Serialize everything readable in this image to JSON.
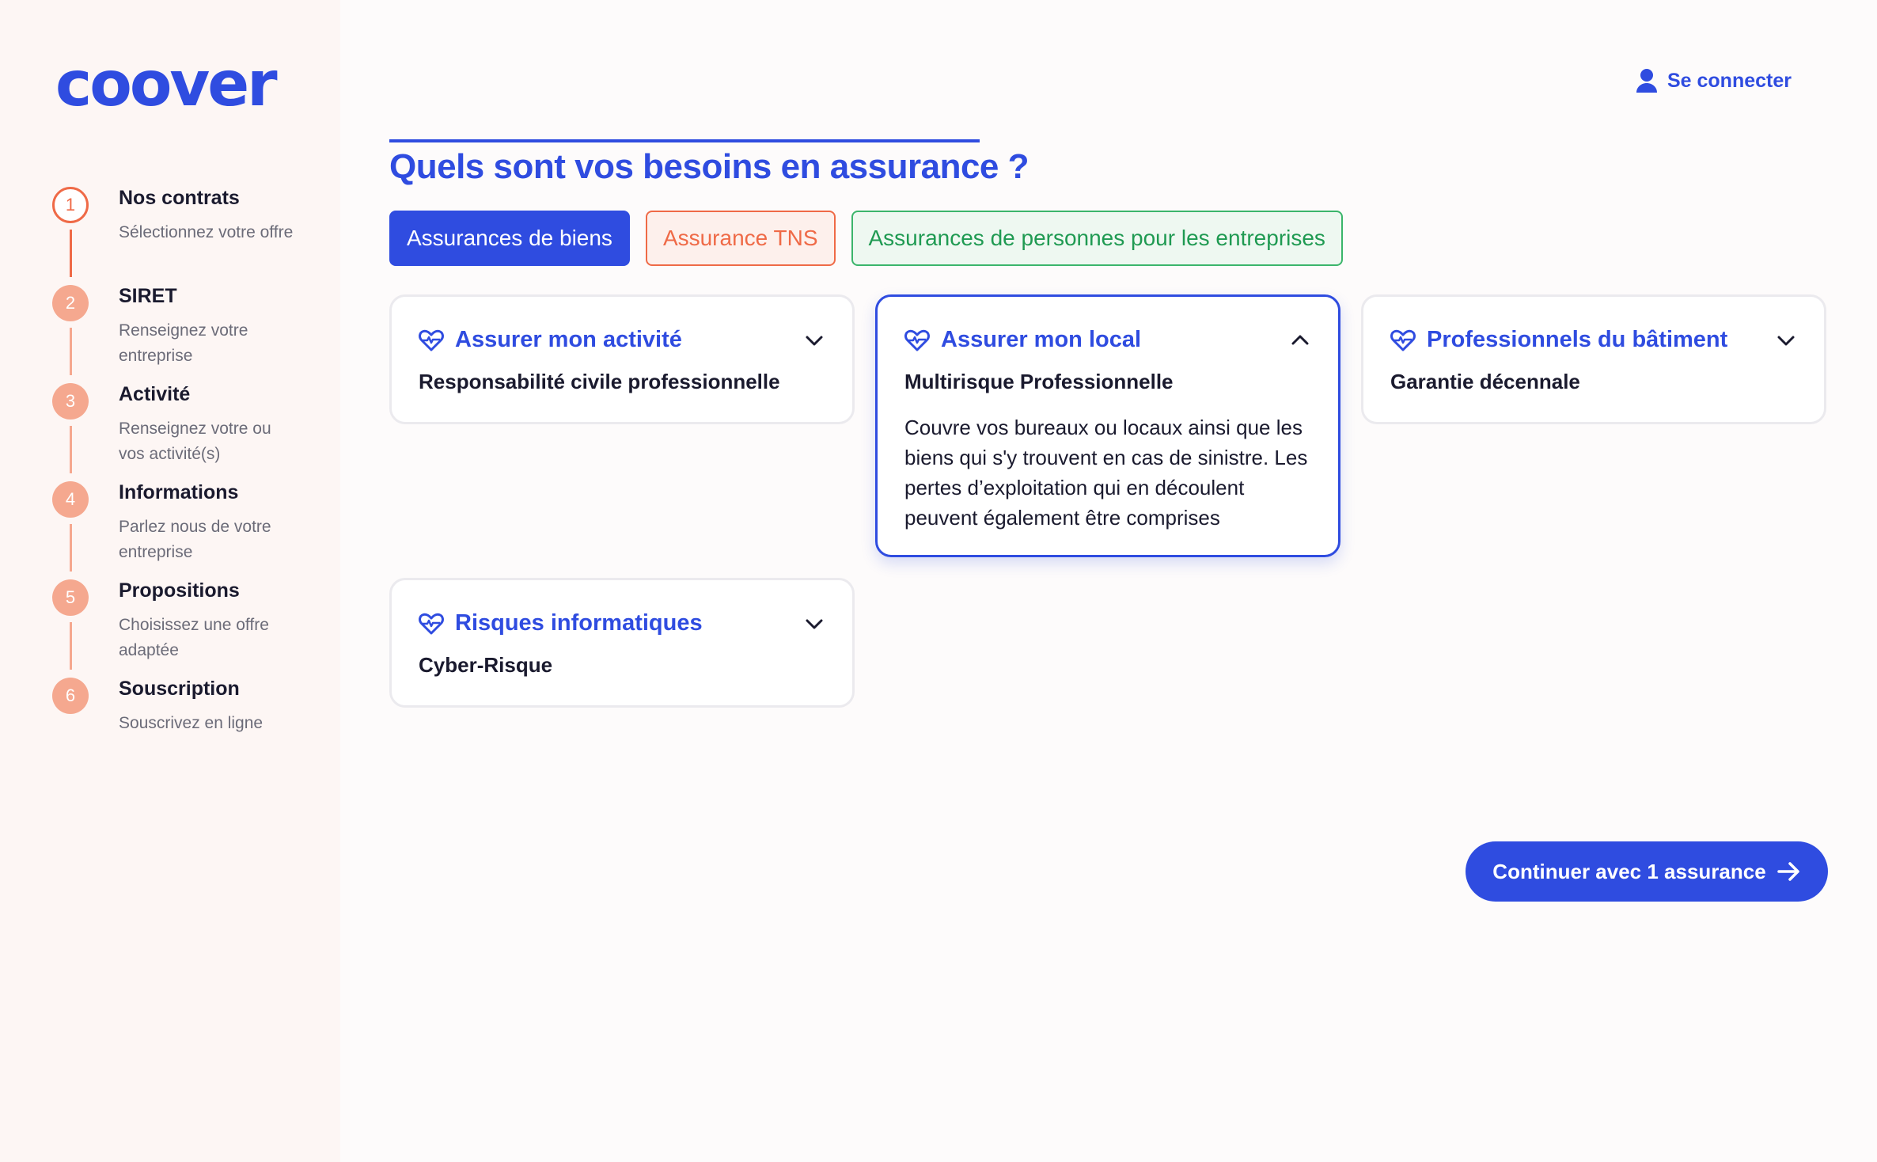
{
  "brand": {
    "logo": "coover"
  },
  "header": {
    "login_label": "Se connecter",
    "login_icon": "user-icon"
  },
  "steps": [
    {
      "num": "1",
      "title": "Nos contrats",
      "desc": "Sélectionnez votre offre",
      "active": true
    },
    {
      "num": "2",
      "title": "SIRET",
      "desc": "Renseignez votre entreprise",
      "active": false
    },
    {
      "num": "3",
      "title": "Activité",
      "desc": "Renseignez votre ou vos activité(s)",
      "active": false
    },
    {
      "num": "4",
      "title": "Informations",
      "desc": "Parlez nous de votre entreprise",
      "active": false
    },
    {
      "num": "5",
      "title": "Propositions",
      "desc": "Choisissez une offre adaptée",
      "active": false
    },
    {
      "num": "6",
      "title": "Souscription",
      "desc": "Souscrivez en ligne",
      "active": false
    }
  ],
  "main": {
    "title": "Quels sont vos besoins en assurance ?",
    "tabs": [
      {
        "label": "Assurances de biens",
        "style": "blue",
        "selected": true
      },
      {
        "label": "Assurance TNS",
        "style": "orange",
        "selected": false
      },
      {
        "label": "Assurances de personnes pour les entreprises",
        "style": "green",
        "selected": false
      }
    ],
    "cards": [
      {
        "title": "Assurer mon activité",
        "subtitle": "Responsabilité civile professionnelle",
        "expanded": false,
        "icon": "heart-pulse-icon"
      },
      {
        "title": "Assurer mon local",
        "subtitle": "Multirisque Professionnelle",
        "expanded": true,
        "icon": "heart-pulse-icon",
        "description": "Couvre vos bureaux ou locaux ainsi que les biens qui s'y trouvent en cas de sinistre. Les pertes d’exploitation qui en découlent peuvent également être comprises"
      },
      {
        "title": "Professionnels du bâtiment",
        "subtitle": "Garantie décennale",
        "expanded": false,
        "icon": "heart-pulse-icon"
      },
      {
        "title": "Risques informatiques",
        "subtitle": "Cyber-Risque",
        "expanded": false,
        "icon": "heart-pulse-icon"
      }
    ],
    "continue_label": "Continuer avec 1 assurance"
  },
  "colors": {
    "primary": "#2f4ce0",
    "accent_orange": "#ef6a47",
    "accent_green": "#1f9a52"
  }
}
